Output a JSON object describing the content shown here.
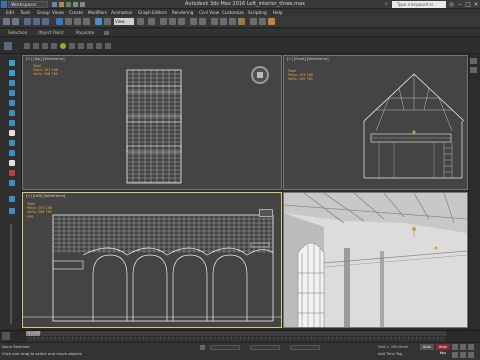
{
  "titlebar": {
    "workspace": "Workspace: Default",
    "title": "Autodesk 3ds Max 2016    Loft_interior_three.max",
    "search_placeholder": "Type a keyword or phrase"
  },
  "menu": [
    "Edit",
    "Tools",
    "Group",
    "Views",
    "Create",
    "Modifiers",
    "Animation",
    "Graph Editors",
    "Rendering",
    "Civil View",
    "Customize",
    "Scripting",
    "Help"
  ],
  "toolbar": {
    "view_select": "View"
  },
  "ribbon": {
    "tabs": [
      "Selection",
      "Object Paint",
      "Populate"
    ]
  },
  "viewports": {
    "top": {
      "label": "[+] [Top] [Wireframe]"
    },
    "front": {
      "label": "[+] [Front] [Wireframe]"
    },
    "left": {
      "label": "[+] [Left] [Wireframe]"
    },
    "persp": {
      "label": ""
    }
  },
  "stats": {
    "total": "Total",
    "polys_label": "Polys:",
    "polys_value": "193 168",
    "verts_label": "Verts:",
    "verts_value": "206 785",
    "fps_label": "FPS:"
  },
  "timeline": {
    "readout": "0 / 100"
  },
  "status": {
    "selection": "None Selected",
    "prompt": "Click and drag to select and move objects",
    "grid": "Grid = 100,0mm",
    "add_time_tag": "Add Time Tag",
    "auto": "Auto",
    "autokey": "Auto Key"
  },
  "colors": {
    "accent_active": "#d8c870",
    "stats_text": "#e8a840",
    "viewport_bg": "#444444",
    "wire": "#f0f0f0"
  }
}
